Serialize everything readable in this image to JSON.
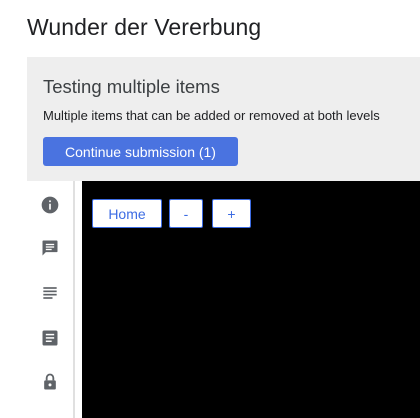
{
  "header": {
    "title": "Wunder der Vererbung"
  },
  "banner": {
    "title": "Testing multiple items",
    "description": "Multiple items that can be added or removed at both levels",
    "continue_label": "Continue submission (1)"
  },
  "sidebar": {
    "items": [
      {
        "icon": "info-icon"
      },
      {
        "icon": "chat-icon"
      },
      {
        "icon": "notes-icon"
      },
      {
        "icon": "document-icon"
      },
      {
        "icon": "lock-icon"
      }
    ]
  },
  "canvas": {
    "home_label": "Home",
    "minus_label": "-",
    "plus_label": "+"
  },
  "colors": {
    "accent": "#4a73e0",
    "banner_bg": "#eeeeee",
    "canvas_bg": "#000000",
    "icon": "#5f6368"
  }
}
